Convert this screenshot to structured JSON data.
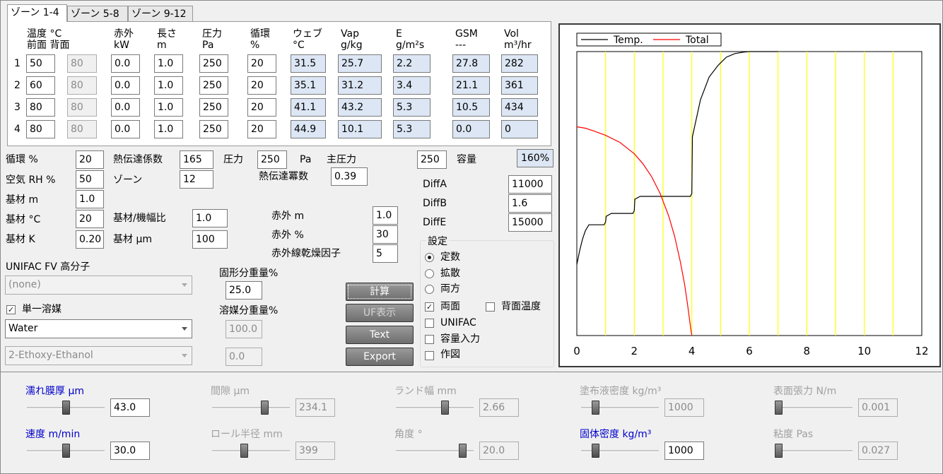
{
  "tabs": [
    "ゾーン 1-4",
    "ゾーン 5-8",
    "ゾーン 9-12"
  ],
  "zone_table": {
    "headers": [
      {
        "l1": "温度 °C",
        "l2": "前面 背面"
      },
      {
        "l1": "赤外",
        "l2": "kW"
      },
      {
        "l1": "長さ",
        "l2": "m"
      },
      {
        "l1": "圧力",
        "l2": "Pa"
      },
      {
        "l1": "循環",
        "l2": "%"
      },
      {
        "l1": "ウェブ",
        "l2": "°C"
      },
      {
        "l1": "Vap",
        "l2": "g/kg"
      },
      {
        "l1": "E",
        "l2": "g/m²s"
      },
      {
        "l1": "GSM",
        "l2": "---"
      },
      {
        "l1": "Vol",
        "l2": "m³/hr"
      }
    ],
    "rows": [
      {
        "n": "1",
        "front": "50",
        "back": "80",
        "ir": "0.0",
        "len": "1.0",
        "pres": "250",
        "circ": "20",
        "web": "31.5",
        "vap": "25.7",
        "e": "2.2",
        "gsm": "27.8",
        "vol": "282"
      },
      {
        "n": "2",
        "front": "60",
        "back": "80",
        "ir": "0.0",
        "len": "1.0",
        "pres": "250",
        "circ": "20",
        "web": "35.1",
        "vap": "31.2",
        "e": "3.4",
        "gsm": "21.1",
        "vol": "361"
      },
      {
        "n": "3",
        "front": "80",
        "back": "80",
        "ir": "0.0",
        "len": "1.0",
        "pres": "250",
        "circ": "20",
        "web": "41.1",
        "vap": "43.2",
        "e": "5.3",
        "gsm": "10.5",
        "vol": "434"
      },
      {
        "n": "4",
        "front": "80",
        "back": "80",
        "ir": "0.0",
        "len": "1.0",
        "pres": "250",
        "circ": "20",
        "web": "44.9",
        "vap": "10.1",
        "e": "5.3",
        "gsm": "0.0",
        "vol": "0"
      }
    ]
  },
  "params": {
    "circ_label": "循環 %",
    "circ": "20",
    "htc_label": "熱伝達係数",
    "htc": "165",
    "pres_label": "圧力",
    "pres": "250",
    "pa_label": "Pa",
    "main_pres_label": "主圧力",
    "main_pres": "250",
    "capacity_label": "容量",
    "capacity": "160%",
    "rh_label": "空気 RH %",
    "rh": "50",
    "zones_label": "ゾーン",
    "zones": "12",
    "htexp_label": "熱伝達冪数",
    "htexp": "0.39",
    "diffa_label": "DiffA",
    "diffa": "11000",
    "diffb_label": "DiffB",
    "diffb": "1.6",
    "diffe_label": "DiffE",
    "diffe": "15000",
    "sub_m_label": "基材 m",
    "sub_m": "1.0",
    "sub_c_label": "基材 °C",
    "sub_c": "20",
    "sub_ratio_label": "基材/機幅比",
    "sub_ratio": "1.0",
    "sub_k_label": "基材 K",
    "sub_k": "0.20",
    "sub_um_label": "基材 µm",
    "sub_um": "100",
    "ir_m_label": "赤外 m",
    "ir_m": "1.0",
    "ir_pct_label": "赤外 %",
    "ir_pct": "30",
    "ir_factor_label": "赤外線乾燥因子",
    "ir_factor": "5",
    "unifac_label": "UNIFAC FV 高分子",
    "unifac_value": "(none)",
    "solid_label": "固形分重量%",
    "solid": "25.0",
    "solvent_label": "溶媒分重量%",
    "solvent1": "100.0",
    "solvent2": "0.0",
    "single_solvent_label": "単一溶媒",
    "solvent1_name": "Water",
    "solvent2_name": "2-Ethoxy-Ethanol"
  },
  "buttons": {
    "calc": "計算",
    "uf": "UF表示",
    "text": "Text",
    "export": "Export"
  },
  "settings": {
    "title": "設定",
    "radio_const": "定数",
    "radio_diff": "拡散",
    "radio_both": "両方",
    "both_sides": "両面",
    "back_temp": "背面温度",
    "unifac": "UNIFAC",
    "cap_input": "容量入力",
    "plot": "作図"
  },
  "sliders": [
    {
      "label": "濡れ膜厚",
      "unit": "µm",
      "value": "43.0",
      "active": true,
      "level": 0.5
    },
    {
      "label": "間隙",
      "unit": "µm",
      "value": "234.1",
      "active": false,
      "level": 0.7
    },
    {
      "label": "ランド幅",
      "unit": "mm",
      "value": "2.66",
      "active": false,
      "level": 0.65
    },
    {
      "label": "塗布液密度",
      "unit": "kg/m³",
      "value": "1000",
      "active": false,
      "level": 0.15
    },
    {
      "label": "表面張力",
      "unit": "N/m",
      "value": "0.001",
      "active": false,
      "level": 0.0
    },
    {
      "label": "速度",
      "unit": "m/min",
      "value": "30.0",
      "active": true,
      "level": 0.5
    },
    {
      "label": "ロール半径",
      "unit": "mm",
      "value": "399",
      "active": false,
      "level": 0.4
    },
    {
      "label": "角度",
      "unit": "°",
      "value": "20.0",
      "active": false,
      "level": 0.9
    },
    {
      "label": "固体密度",
      "unit": "kg/m³",
      "value": "1000",
      "active": true,
      "level": 0.15
    },
    {
      "label": "粘度",
      "unit": "Pas",
      "value": "0.027",
      "active": false,
      "level": 0.0
    }
  ],
  "chart_data": {
    "type": "line",
    "title": "",
    "xlabel": "",
    "ylabel": "",
    "xlim": [
      0,
      12
    ],
    "ylim": [
      0,
      1
    ],
    "x_ticks": [
      "0",
      "2",
      "4",
      "6",
      "8",
      "10",
      "12"
    ],
    "legend": "top-left",
    "zone_boundaries": [
      1,
      2,
      3,
      4,
      5,
      6,
      7,
      8,
      9,
      10,
      11
    ],
    "series": [
      {
        "name": "Temp.",
        "color": "#000000",
        "x": [
          0,
          0.1,
          0.2,
          0.3,
          0.42,
          0.6,
          0.8,
          0.95,
          1.0,
          1.02,
          1.2,
          1.5,
          1.8,
          1.95,
          2.0,
          2.02,
          2.2,
          2.6,
          3.0,
          3.4,
          3.8,
          3.95,
          4.0,
          4.02,
          4.3,
          4.6,
          4.9,
          5.0,
          5.2,
          5.5,
          5.8,
          6.0,
          6.2,
          6.5,
          7.0
        ],
        "y": [
          0.25,
          0.3,
          0.34,
          0.37,
          0.39,
          0.39,
          0.39,
          0.39,
          0.4,
          0.42,
          0.43,
          0.43,
          0.43,
          0.43,
          0.44,
          0.48,
          0.49,
          0.49,
          0.49,
          0.49,
          0.49,
          0.49,
          0.5,
          0.7,
          0.83,
          0.91,
          0.95,
          0.96,
          0.98,
          0.993,
          0.998,
          1.0,
          1.0,
          1.0,
          1.0
        ]
      },
      {
        "name": "Total",
        "color": "#ff0000",
        "x": [
          0,
          0.3,
          0.6,
          1.0,
          1.5,
          2.0,
          2.3,
          2.6,
          2.9,
          3.2,
          3.4,
          3.6,
          3.75,
          3.85,
          3.93,
          3.97,
          4.0
        ],
        "y": [
          0.735,
          0.73,
          0.72,
          0.705,
          0.68,
          0.64,
          0.605,
          0.56,
          0.5,
          0.42,
          0.35,
          0.26,
          0.18,
          0.11,
          0.05,
          0.02,
          0.0
        ]
      }
    ]
  }
}
